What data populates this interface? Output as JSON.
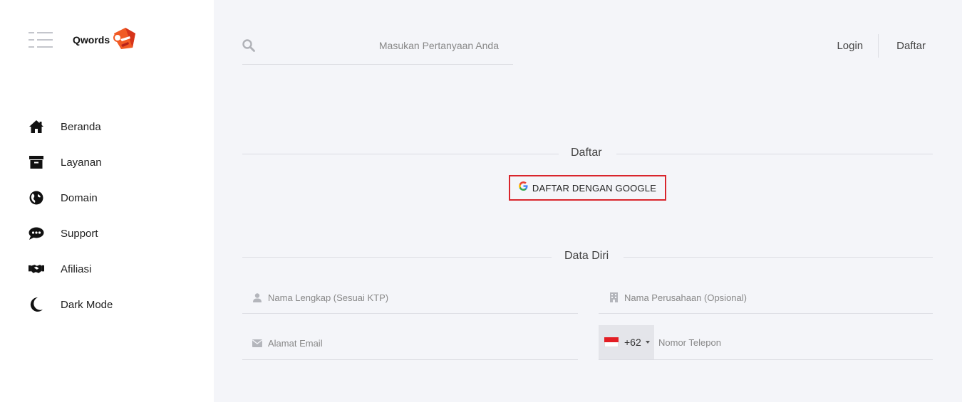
{
  "brand": {
    "name": "Qwords"
  },
  "sidebar": {
    "items": [
      {
        "label": "Beranda",
        "icon": "home-icon"
      },
      {
        "label": "Layanan",
        "icon": "archive-box-icon"
      },
      {
        "label": "Domain",
        "icon": "globe-icon"
      },
      {
        "label": "Support",
        "icon": "chat-bubble-icon"
      },
      {
        "label": "Afiliasi",
        "icon": "handshake-icon"
      },
      {
        "label": "Dark Mode",
        "icon": "moon-icon"
      }
    ]
  },
  "search": {
    "placeholder": "Masukan Pertanyaan Anda"
  },
  "header": {
    "login": "Login",
    "register": "Daftar"
  },
  "register_section": {
    "title": "Daftar",
    "google_button": "DAFTAR DENGAN GOOGLE"
  },
  "personal_section": {
    "title": "Data Diri",
    "fields": {
      "full_name": "Nama Lengkap (Sesuai KTP)",
      "company": "Nama Perusahaan (Opsional)",
      "email": "Alamat Email",
      "phone": "Nomor Telepon"
    },
    "phone_prefix": "+62"
  },
  "colors": {
    "accent_red": "#d9252c",
    "logo_orange": "#f15a24"
  }
}
